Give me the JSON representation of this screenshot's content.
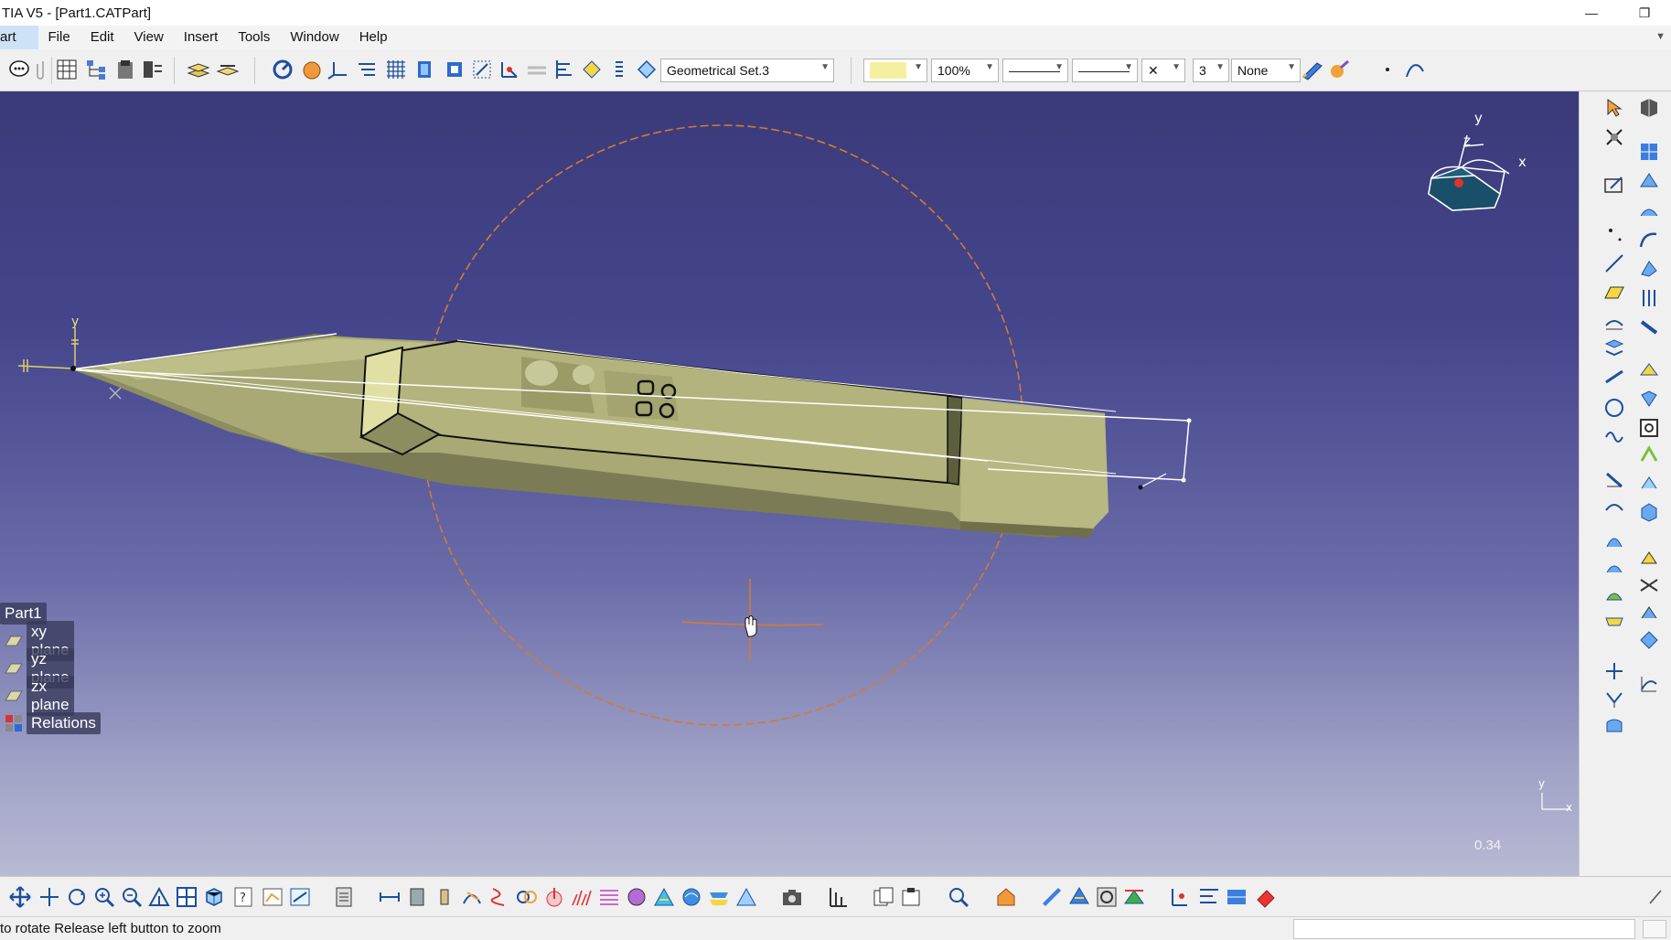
{
  "window": {
    "title": "TIA V5 - [Part1.CATPart]",
    "minimize_glyph": "—",
    "restore_glyph": "❐"
  },
  "menu": {
    "items": [
      "art",
      "File",
      "Edit",
      "View",
      "Insert",
      "Tools",
      "Window",
      "Help"
    ]
  },
  "toolbar": {
    "geometrical_set": "Geometrical Set.3",
    "zoom": "100%",
    "line_type_1": "————",
    "line_type_2": "————",
    "clear_glyph": "✕",
    "layer": "3",
    "layer_filter": "None"
  },
  "tree": {
    "root": "Part1",
    "items": [
      "xy plane",
      "yz plane",
      "zx plane",
      "Relations"
    ]
  },
  "compass": {
    "x_label": "x",
    "y_label": "y",
    "z_label": "z"
  },
  "part_axis": {
    "y_label": "y"
  },
  "viewport": {
    "zoom_readout": "0.34",
    "mini_axis_y": "y",
    "mini_axis_x": "x"
  },
  "status": {
    "message": "to rotate  Release left button to zoom"
  },
  "colors": {
    "viewport_top": "#3a3a7a",
    "viewport_bottom": "#b8b9d2",
    "part_light": "#c9c98f",
    "part_mid": "#9e9f6a",
    "part_dark": "#6f6f4a",
    "rotation_circle": "#d47a34",
    "menu_highlight": "#cde2f7"
  }
}
